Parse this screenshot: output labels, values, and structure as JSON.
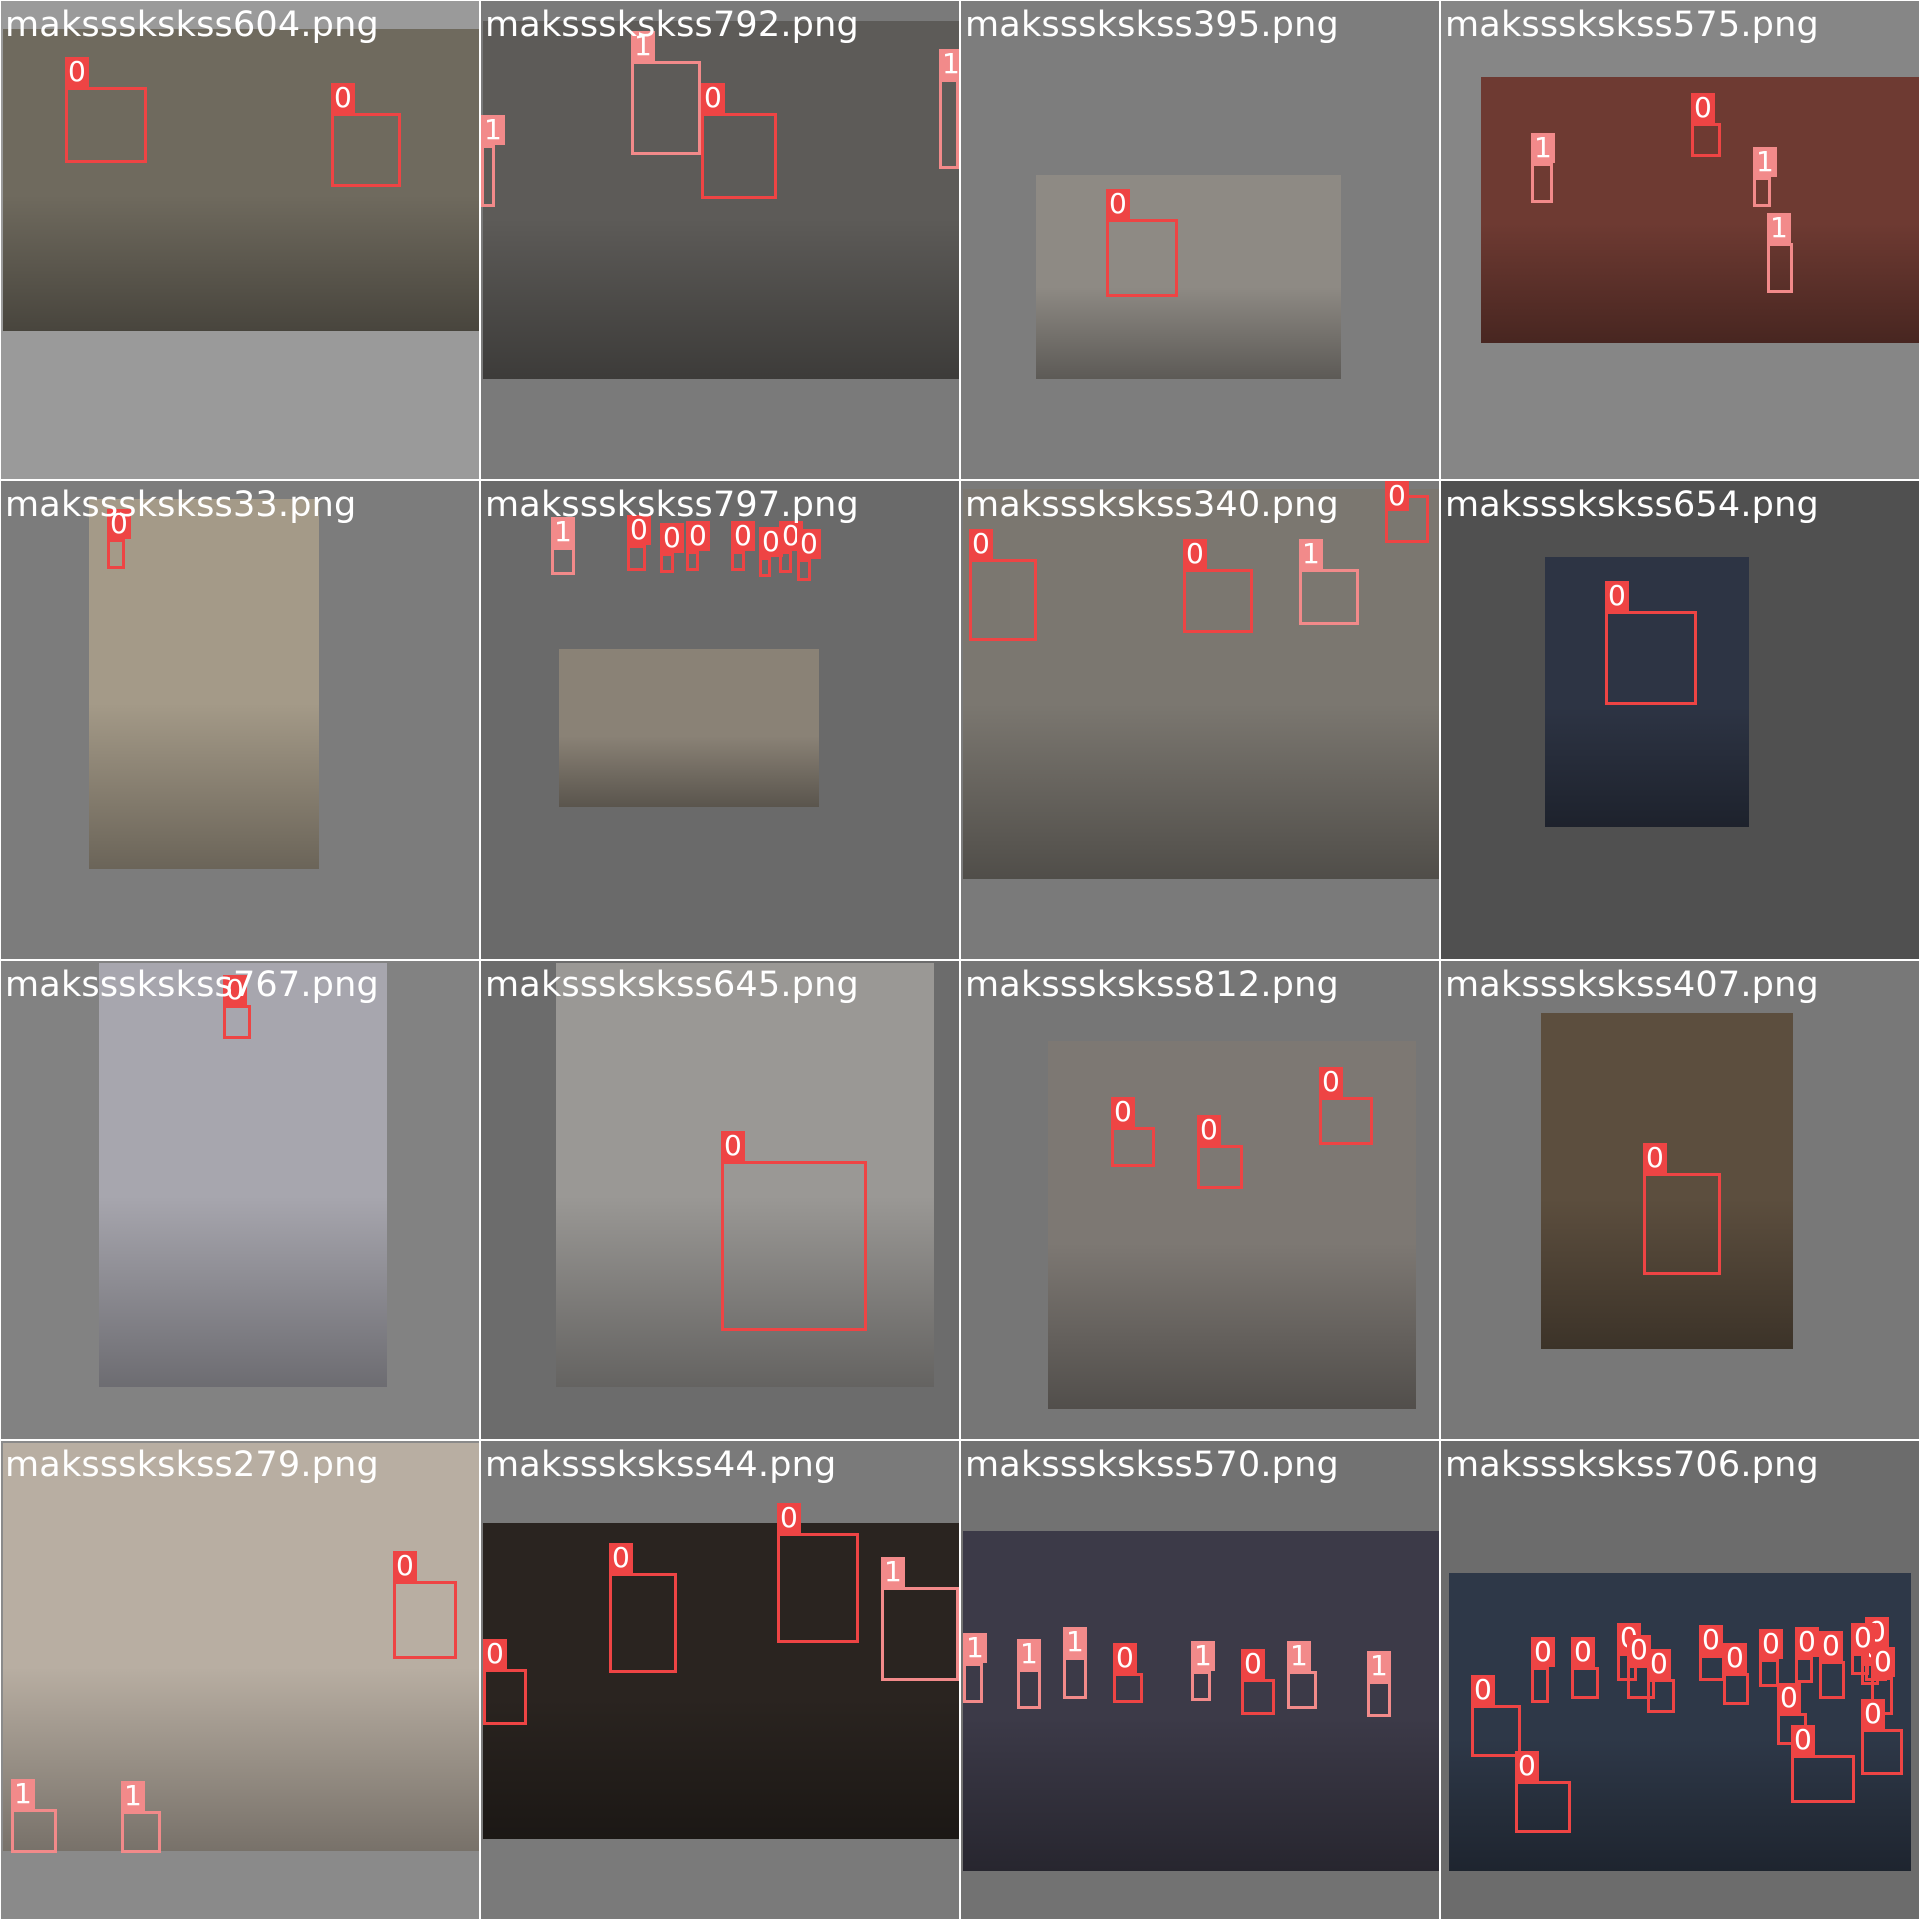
{
  "colors": {
    "box_class_0": "#ee4444",
    "box_class_1": "#f28a8a",
    "label_text": "#ffffff"
  },
  "tiles": [
    {
      "filename": "makssskskss604.png",
      "bg": "#9a9a9a",
      "photo_color": "#6f6a5e",
      "boxes": [
        {
          "cls": "0"
        },
        {
          "cls": "0"
        }
      ]
    },
    {
      "filename": "makssskskss792.png",
      "bg": "#7a7a7a",
      "photo_color": "#5d5b58",
      "boxes": [
        {
          "cls": "1"
        },
        {
          "cls": "0"
        },
        {
          "cls": "1"
        },
        {
          "cls": "1"
        }
      ]
    },
    {
      "filename": "makssskskss395.png",
      "bg": "#7d7d7d",
      "photo_color": "#8e8a84",
      "boxes": [
        {
          "cls": "0"
        }
      ]
    },
    {
      "filename": "makssskskss575.png",
      "bg": "#868686",
      "photo_color": "#6e3a32",
      "boxes": [
        {
          "cls": "0"
        },
        {
          "cls": "1"
        },
        {
          "cls": "1"
        },
        {
          "cls": "1"
        }
      ]
    },
    {
      "filename": "makssskskss33.png",
      "bg": "#7c7c7c",
      "photo_color": "#a49a88",
      "boxes": [
        {
          "cls": "0"
        }
      ]
    },
    {
      "filename": "makssskskss797.png",
      "bg": "#6a6a6a",
      "photo_color": "#8a8276",
      "boxes": [
        {
          "cls": "1"
        },
        {
          "cls": "0"
        },
        {
          "cls": "0"
        },
        {
          "cls": "0"
        },
        {
          "cls": "0"
        },
        {
          "cls": "0"
        },
        {
          "cls": "0"
        },
        {
          "cls": "0"
        }
      ]
    },
    {
      "filename": "makssskskss340.png",
      "bg": "#7a7a7a",
      "photo_color": "#7b7770",
      "boxes": [
        {
          "cls": "0"
        },
        {
          "cls": "0"
        },
        {
          "cls": "1"
        },
        {
          "cls": "0"
        }
      ]
    },
    {
      "filename": "makssskskss654.png",
      "bg": "#505050",
      "photo_color": "#2d3444",
      "boxes": [
        {
          "cls": "0"
        }
      ]
    },
    {
      "filename": "makssskskss767.png",
      "bg": "#828282",
      "photo_color": "#a7a6ae",
      "boxes": [
        {
          "cls": "0"
        }
      ]
    },
    {
      "filename": "makssskskss645.png",
      "bg": "#6c6c6c",
      "photo_color": "#9a9895",
      "boxes": [
        {
          "cls": "0"
        }
      ]
    },
    {
      "filename": "makssskskss812.png",
      "bg": "#767676",
      "photo_color": "#7d7873",
      "boxes": [
        {
          "cls": "0"
        },
        {
          "cls": "0"
        },
        {
          "cls": "0"
        }
      ]
    },
    {
      "filename": "makssskskss407.png",
      "bg": "#787878",
      "photo_color": "#5c4e3e",
      "boxes": [
        {
          "cls": "0"
        }
      ]
    },
    {
      "filename": "makssskskss279.png",
      "bg": "#8a8a8a",
      "photo_color": "#b8aea2",
      "boxes": [
        {
          "cls": "0"
        },
        {
          "cls": "1"
        },
        {
          "cls": "1"
        }
      ]
    },
    {
      "filename": "makssskskss44.png",
      "bg": "#7a7a7a",
      "photo_color": "#2a2420",
      "boxes": [
        {
          "cls": "1"
        },
        {
          "cls": "0"
        },
        {
          "cls": "0"
        },
        {
          "cls": "0"
        }
      ]
    },
    {
      "filename": "makssskskss570.png",
      "bg": "#727272",
      "photo_color": "#3c3a48",
      "boxes": [
        {
          "cls": "1"
        },
        {
          "cls": "1"
        },
        {
          "cls": "1"
        },
        {
          "cls": "0"
        },
        {
          "cls": "1"
        },
        {
          "cls": "0"
        },
        {
          "cls": "1"
        },
        {
          "cls": "1"
        }
      ]
    },
    {
      "filename": "makssskskss706.png",
      "bg": "#6c6c6c",
      "photo_color": "#2e3848",
      "boxes": [
        {
          "cls": "0"
        },
        {
          "cls": "0"
        },
        {
          "cls": "0"
        },
        {
          "cls": "0"
        },
        {
          "cls": "0"
        },
        {
          "cls": "0"
        },
        {
          "cls": "0"
        },
        {
          "cls": "0"
        },
        {
          "cls": "0"
        },
        {
          "cls": "0"
        },
        {
          "cls": "0"
        },
        {
          "cls": "0"
        },
        {
          "cls": "0"
        },
        {
          "cls": "0"
        },
        {
          "cls": "0"
        },
        {
          "cls": "0"
        },
        {
          "cls": "0"
        },
        {
          "cls": "0"
        },
        {
          "cls": "0"
        }
      ]
    }
  ]
}
